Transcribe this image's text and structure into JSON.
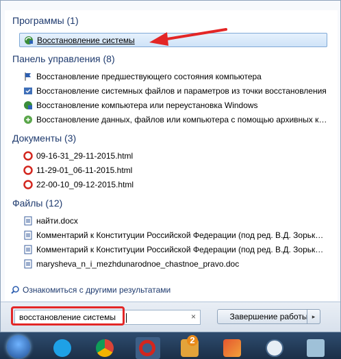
{
  "groups": [
    {
      "title": "Программы (1)",
      "items": [
        "Восстановление системы"
      ]
    },
    {
      "title": "Панель управления (8)",
      "items": [
        "Восстановление предшествующего состояния компьютера",
        "Восстановление системных файлов и параметров из точки восстановления",
        "Восстановление компьютера или переустановка Windows",
        "Восстановление данных, файлов или компьютера с помощью архивных ко..."
      ]
    },
    {
      "title": "Документы (3)",
      "items": [
        "09-16-31_29-11-2015.html",
        "11-29-01_06-11-2015.html",
        "22-00-10_09-12-2015.html"
      ]
    },
    {
      "title": "Файлы (12)",
      "items": [
        "найти.docx",
        "Комментарий к Конституции Российской Федерации (под ред. В.Д. Зорьки.d...",
        "Комментарий к Конституции Российской Федерации (под ред. В.Д. Зорьки.d...",
        "marysheva_n_i_mezhdunarodnoe_chastnoe_pravo.doc"
      ]
    }
  ],
  "more_results": "Ознакомиться с другими результатами",
  "search": {
    "value": "восстановление системы",
    "clear": "×"
  },
  "shutdown": {
    "label": "Завершение работы",
    "arrow": "▸"
  },
  "taskbar_badge": "2"
}
